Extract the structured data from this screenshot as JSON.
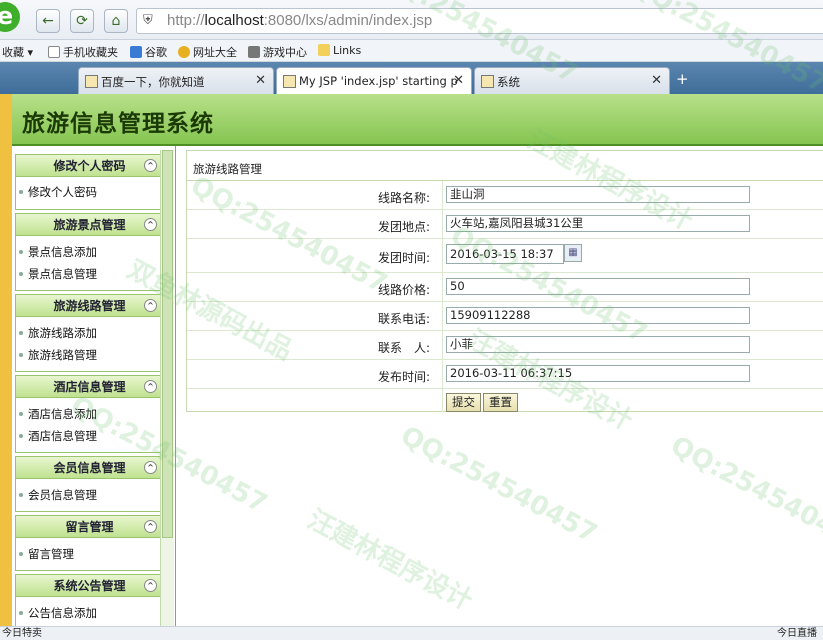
{
  "browser": {
    "url_prefix": "http://",
    "url_host": "localhost",
    "url_rest": ":8080/lxs/admin/index.jsp",
    "favorites": [
      {
        "label": "收藏 ▾"
      },
      {
        "label": "手机收藏夹"
      },
      {
        "label": "谷歌"
      },
      {
        "label": "网址大全"
      },
      {
        "label": "游戏中心"
      },
      {
        "label": "Links"
      }
    ],
    "tabs": [
      {
        "label": "百度一下，你就知道"
      },
      {
        "label": "My JSP 'index.jsp' starting p"
      },
      {
        "label": "系统"
      }
    ],
    "status_left": "今日特卖",
    "status_right": "今日直播"
  },
  "app": {
    "title": "旅游信息管理系统"
  },
  "sidebar": {
    "groups": [
      {
        "title": "修改个人密码",
        "items": [
          "修改个人密码"
        ]
      },
      {
        "title": "旅游景点管理",
        "items": [
          "景点信息添加",
          "景点信息管理"
        ]
      },
      {
        "title": "旅游线路管理",
        "items": [
          "旅游线路添加",
          "旅游线路管理"
        ]
      },
      {
        "title": "酒店信息管理",
        "items": [
          "酒店信息添加",
          "酒店信息管理"
        ]
      },
      {
        "title": "会员信息管理",
        "items": [
          "会员信息管理"
        ]
      },
      {
        "title": "留言管理",
        "items": [
          "留言管理"
        ]
      },
      {
        "title": "系统公告管理",
        "items": [
          "公告信息添加"
        ]
      }
    ]
  },
  "form": {
    "panel_title": "旅游线路管理",
    "fields": [
      {
        "label": "线路名称:",
        "value": "韭山洞"
      },
      {
        "label": "发团地点:",
        "value": "火车站,嘉凤阳县城31公里"
      },
      {
        "label": "发团时间:",
        "value": "2016-03-15 18:37"
      },
      {
        "label": "线路价格:",
        "value": "50"
      },
      {
        "label": "联系电话:",
        "value": "15909112288"
      },
      {
        "label": "联系　人:",
        "value": "小菲"
      },
      {
        "label": "发布时间:",
        "value": "2016-03-11 06:37:15"
      }
    ],
    "submit_label": "提交",
    "reset_label": "重置"
  },
  "watermarks": [
    "QQ:254540457",
    "汪建林程序设计",
    "双鱼林源码出品"
  ]
}
